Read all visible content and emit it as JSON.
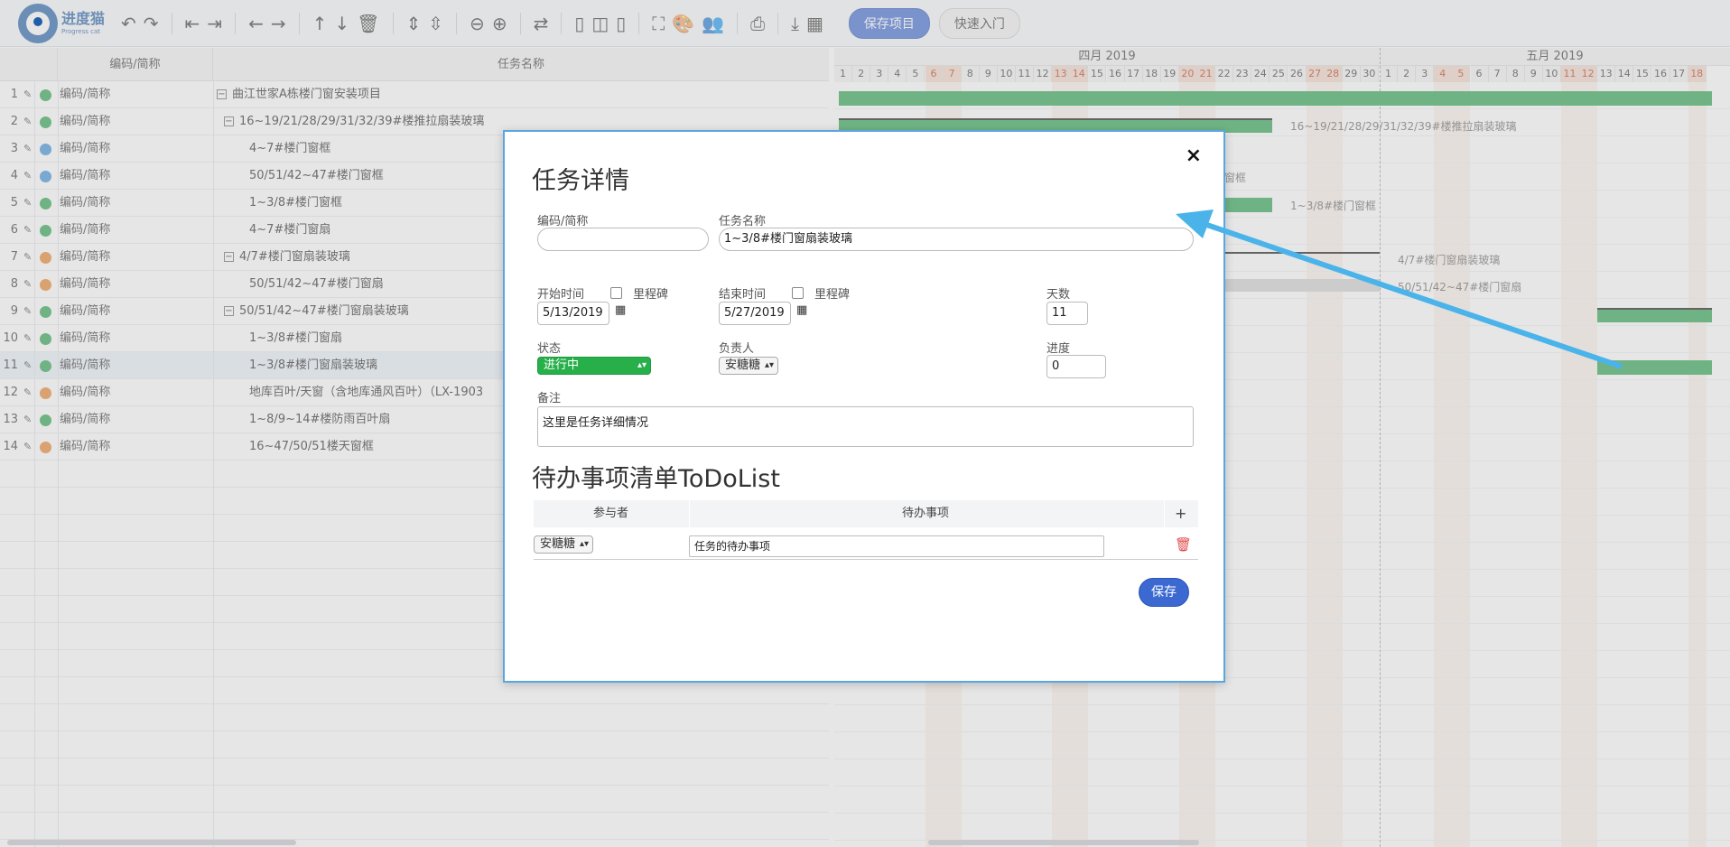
{
  "toolbar": {
    "logo_cn": "进度猫",
    "logo_en": "Progress cat",
    "save_project": "保存项目",
    "quick_start": "快速入门"
  },
  "grid": {
    "headers": [
      "编码/简称",
      "任务名称"
    ],
    "rows": [
      {
        "num": "1",
        "code": "编码/简称",
        "name": "曲江世家A栋楼门窗安装项目",
        "dot": "#27a24d",
        "collapse": "−",
        "indent": 0
      },
      {
        "num": "2",
        "code": "编码/简称",
        "name": "16~19/21/28/29/31/32/39#楼推拉扇装玻璃",
        "dot": "#27a24d",
        "collapse": "−",
        "indent": 1
      },
      {
        "num": "3",
        "code": "编码/简称",
        "name": "4~7#楼门窗框",
        "dot": "#3a8fd8",
        "collapse": "",
        "indent": 2
      },
      {
        "num": "4",
        "code": "编码/简称",
        "name": "50/51/42~47#楼门窗框",
        "dot": "#3a8fd8",
        "collapse": "",
        "indent": 2
      },
      {
        "num": "5",
        "code": "编码/简称",
        "name": "1~3/8#楼门窗框",
        "dot": "#27a24d",
        "collapse": "",
        "indent": 2
      },
      {
        "num": "6",
        "code": "编码/简称",
        "name": "4~7#楼门窗扇",
        "dot": "#27a24d",
        "collapse": "",
        "indent": 2
      },
      {
        "num": "7",
        "code": "编码/简称",
        "name": "4/7#楼门窗扇装玻璃",
        "dot": "#e9832b",
        "collapse": "−",
        "indent": 1
      },
      {
        "num": "8",
        "code": "编码/简称",
        "name": "50/51/42~47#楼门窗扇",
        "dot": "#e9832b",
        "collapse": "",
        "indent": 2
      },
      {
        "num": "9",
        "code": "编码/简称",
        "name": "50/51/42~47#楼门窗扇装玻璃",
        "dot": "#27a24d",
        "collapse": "−",
        "indent": 1
      },
      {
        "num": "10",
        "code": "编码/简称",
        "name": "1~3/8#楼门窗扇",
        "dot": "#27a24d",
        "collapse": "",
        "indent": 2
      },
      {
        "num": "11",
        "code": "编码/简称",
        "name": "1~3/8#楼门窗扇装玻璃",
        "dot": "#27a24d",
        "collapse": "",
        "indent": 2
      },
      {
        "num": "12",
        "code": "编码/简称",
        "name": "地库百叶/天窗（含地库通风百叶）（LX-1903",
        "dot": "#e9832b",
        "collapse": "",
        "indent": 2
      },
      {
        "num": "13",
        "code": "编码/简称",
        "name": "1~8/9~14#楼防雨百叶扇",
        "dot": "#27a24d",
        "collapse": "",
        "indent": 2
      },
      {
        "num": "14",
        "code": "编码/简称",
        "name": "16~47/50/51楼天窗框",
        "dot": "#e9832b",
        "collapse": "",
        "indent": 2
      }
    ]
  },
  "gantt": {
    "months": [
      "四月 2019",
      "五月 2019"
    ],
    "april_days": [
      "1",
      "2",
      "3",
      "4",
      "5",
      "6",
      "7",
      "8",
      "9",
      "10",
      "11",
      "12",
      "13",
      "14",
      "15",
      "16",
      "17",
      "18",
      "19",
      "20",
      "21",
      "22",
      "23",
      "24",
      "25",
      "26",
      "27",
      "28",
      "29",
      "30"
    ],
    "may_days": [
      "1",
      "2",
      "3",
      "4",
      "5",
      "6",
      "7",
      "8",
      "9",
      "10",
      "11",
      "12",
      "13",
      "14",
      "15",
      "16",
      "17",
      "18"
    ],
    "labels": [
      "16~19/21/28/29/31/32/39#楼推拉扇装玻璃",
      "楼门窗框",
      "1~3/8#楼门窗框",
      "4/7#楼门窗扇装玻璃",
      "50/51/42~47#楼门窗扇"
    ]
  },
  "modal": {
    "title": "任务详情",
    "close": "×",
    "code_label": "编码/简称",
    "code_value": "",
    "name_label": "任务名称",
    "name_value": "1~3/8#楼门窗扇装玻璃",
    "start_label": "开始时间",
    "start_milestone": "里程碑",
    "start_value": "5/13/2019",
    "end_label": "结束时间",
    "end_milestone": "里程碑",
    "end_value": "5/27/2019",
    "days_label": "天数",
    "days_value": "11",
    "status_label": "状态",
    "status_value": "进行中",
    "owner_label": "负责人",
    "owner_value": "安糖糖",
    "progress_label": "进度",
    "progress_value": "0",
    "notes_label": "备注",
    "notes_value": "这里是任务详细情况",
    "todo_title": "待办事项清单ToDoList",
    "todo_col_participant": "参与者",
    "todo_col_item": "待办事项",
    "todo_add": "+",
    "todo_participant": "安糖糖",
    "todo_item": "任务的待办事项",
    "save": "保存"
  }
}
